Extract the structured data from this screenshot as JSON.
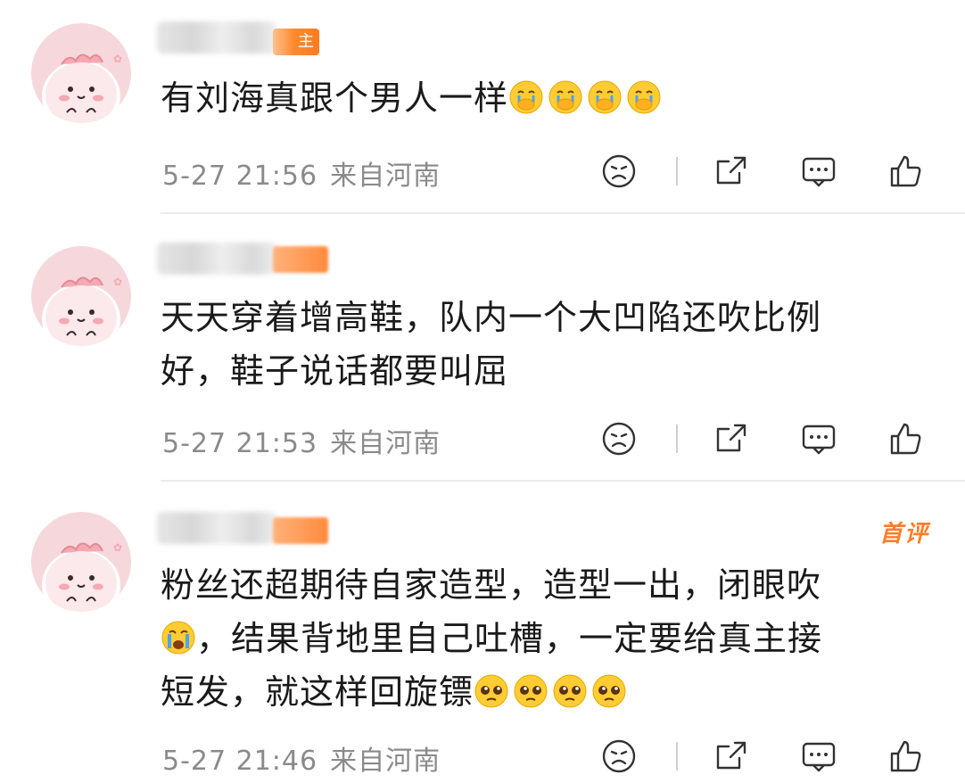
{
  "comments": [
    {
      "badge": "主",
      "text": "有刘海真跟个男人一样",
      "emoji": "crying-cover-mouth",
      "emoji_count": 4,
      "time": "5-27 21:56",
      "location": "来自河南"
    },
    {
      "text_line1": "天天穿着增高鞋，队内一个大凹陷还吹比例",
      "text_line2": "好，鞋子说话都要叫屈",
      "time": "5-27 21:53",
      "location": "来自河南"
    },
    {
      "first_tag": "首评",
      "text_line1": "粉丝还超期待自家造型，造型一出，闭眼吹",
      "text_line2": "，结果背地里自己吐槽，一定要给真主接",
      "text_line3": "短发，就这样回旋镖",
      "emoji_inline": "loud-crying",
      "emoji_trailing": "pleading",
      "emoji_count": 4,
      "time": "5-27 21:46",
      "location": "来自河南"
    }
  ],
  "icons": {
    "dislike": "frown-face-icon",
    "share": "share-icon",
    "reply": "comment-icon",
    "like": "thumbs-up-icon"
  },
  "colors": {
    "badge": "#ff8a3c",
    "first_tag": "#ff7d2a",
    "meta": "#8a8a8a",
    "avatar_bg": "#f6d8dc"
  }
}
